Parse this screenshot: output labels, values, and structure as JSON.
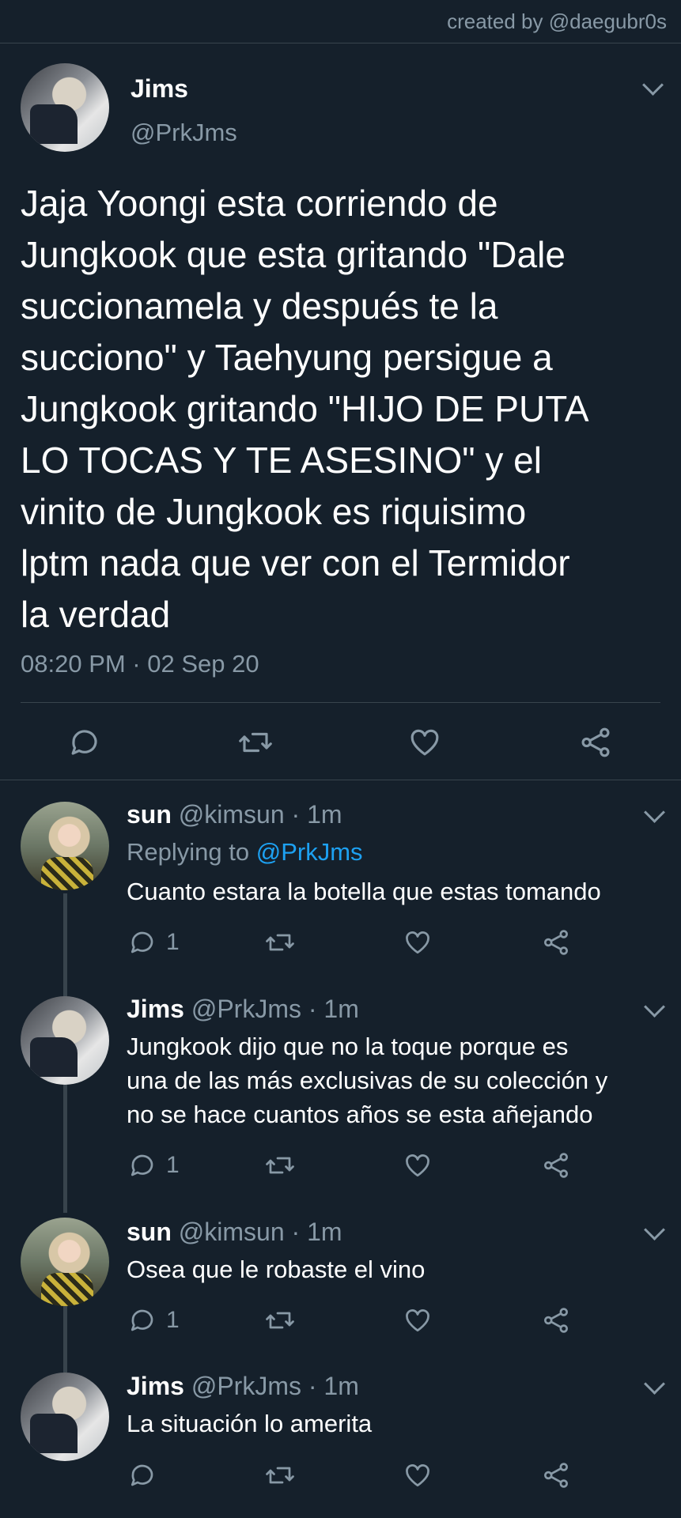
{
  "watermark": "created by @daegubr0s",
  "main_tweet": {
    "name": "Jims",
    "handle": "@PrkJms",
    "text_lines": [
      "Jaja Yoongi esta corriendo de",
      "Jungkook que esta gritando \"Dale",
      "succionamela y después te la",
      "succiono\" y Taehyung persigue a",
      "Jungkook gritando \"HIJO DE PUTA",
      "LO TOCAS Y TE ASESINO\" y el",
      "vinito de Jungkook es riquisimo",
      "lptm nada que ver con el Termidor",
      "la verdad"
    ],
    "timestamp": "08:20 PM · 02 Sep 20"
  },
  "replies": [
    {
      "name": "sun",
      "handle": "@kimsun",
      "time": "· 1m",
      "replying_prefix": "Replying to",
      "replying_to": "@PrkJms",
      "text_lines": [
        "Cuanto estara la botella que estas tomando"
      ],
      "reply_count": "1"
    },
    {
      "name": "Jims",
      "handle": "@PrkJms",
      "time": "· 1m",
      "text_lines": [
        "Jungkook dijo que no la toque porque es",
        "una de las más exclusivas de su colección y",
        "no se hace cuantos años se esta añejando"
      ],
      "reply_count": "1"
    },
    {
      "name": "sun",
      "handle": "@kimsun",
      "time": "· 1m",
      "text_lines": [
        "Osea que le robaste el vino"
      ],
      "reply_count": "1"
    },
    {
      "name": "Jims",
      "handle": "@PrkJms",
      "time": "· 1m",
      "text_lines": [
        "La situación lo amerita"
      ],
      "reply_count": ""
    }
  ],
  "icons": {
    "reply": "comment-icon",
    "retweet": "retweet-icon",
    "like": "heart-icon",
    "share": "share-icon",
    "menu": "chevron-down-icon"
  },
  "colors": {
    "background": "#15202b",
    "secondary_text": "#8899a6",
    "link": "#1da1f2",
    "divider": "#38444d"
  }
}
